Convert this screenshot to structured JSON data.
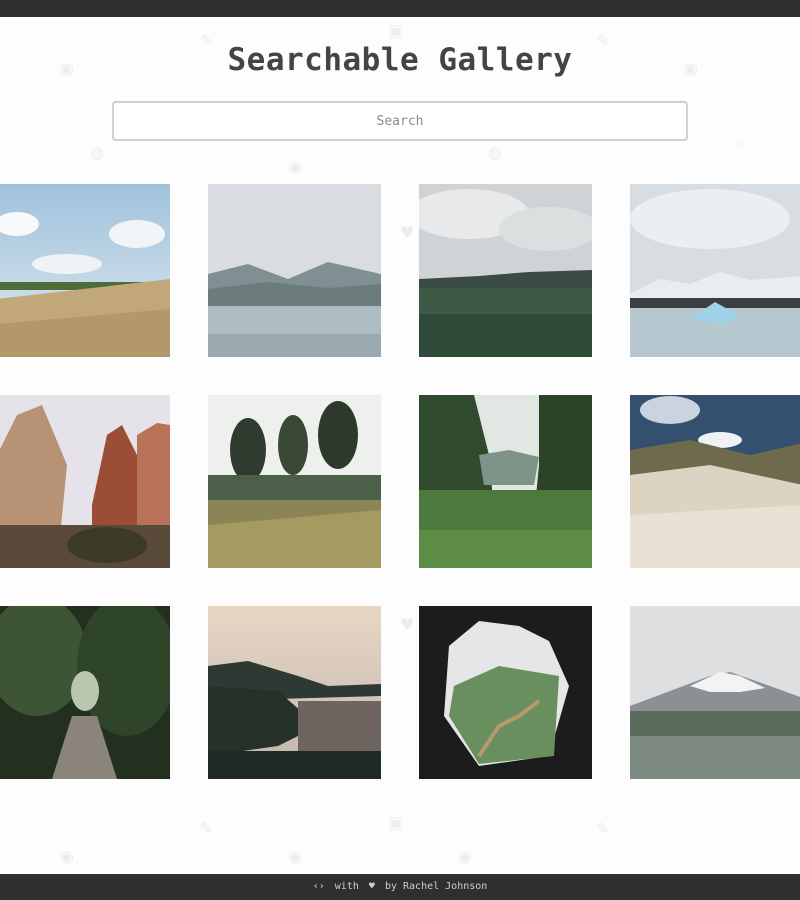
{
  "header": {
    "title": "Searchable Gallery"
  },
  "search": {
    "placeholder": "Search",
    "value": ""
  },
  "gallery": {
    "tiles": [
      {
        "icon": "field-meadow-photo"
      },
      {
        "icon": "mountain-lake-photo"
      },
      {
        "icon": "green-field-cloudy-photo"
      },
      {
        "icon": "glacier-lagoon-photo"
      },
      {
        "icon": "red-rock-canyon-photo"
      },
      {
        "icon": "garden-trees-photo"
      },
      {
        "icon": "green-valley-photo"
      },
      {
        "icon": "sand-dunes-photo"
      },
      {
        "icon": "forest-path-photo"
      },
      {
        "icon": "coastal-sunset-photo"
      },
      {
        "icon": "cave-opening-photo"
      },
      {
        "icon": "snowy-mountain-photo"
      }
    ]
  },
  "footer": {
    "code_glyph": "‹›",
    "with_text": "with",
    "heart_glyph": "♥",
    "by_text": "by Rachel Johnson"
  },
  "colors": {
    "bar": "#2f2f2f",
    "background": "#fdfdfd",
    "title": "#444444"
  }
}
